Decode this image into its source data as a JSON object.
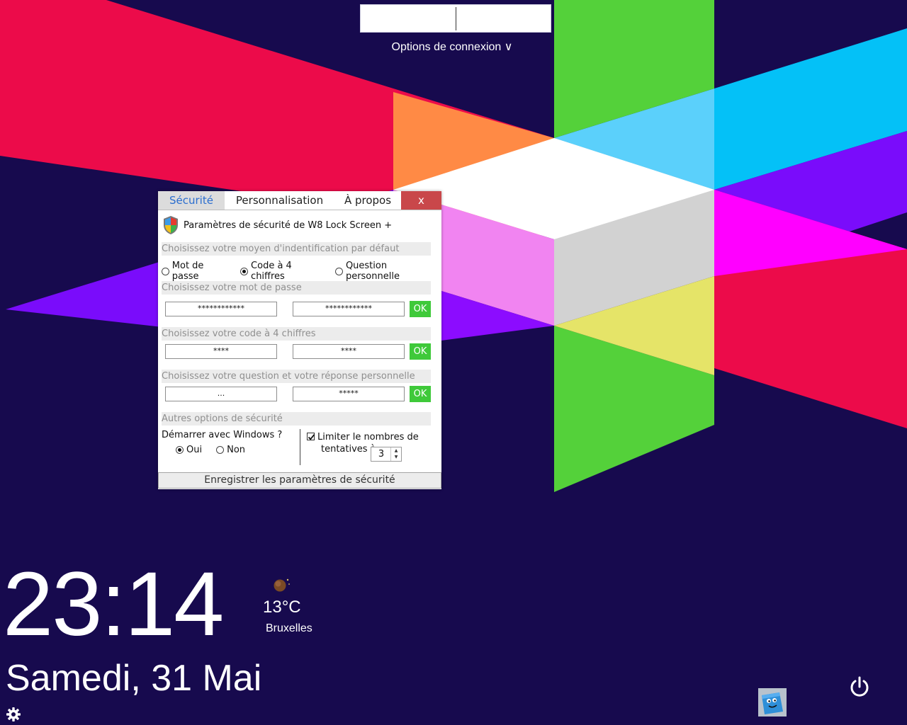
{
  "lock_screen": {
    "login_options_label": "Options de connexion ∨",
    "time": "23:14",
    "date": "Samedi, 31 Mai",
    "weather": {
      "temperature": "13°C",
      "city": "Bruxelles"
    },
    "icons": [
      "settings-gear-icon",
      "sticky-note-app-icon",
      "power-icon",
      "weather-moon-icon"
    ]
  },
  "dialog": {
    "tabs": [
      "Sécurité",
      "Personnalisation",
      "À propos"
    ],
    "active_tab": "Sécurité",
    "close_label": "x",
    "title": "Paramètres de sécurité de W8 Lock Screen +",
    "auth_section": {
      "heading": "Choisissez votre moyen d'indentification par défaut",
      "options": [
        "Mot de passe",
        "Code à 4 chiffres",
        "Question personnelle"
      ],
      "selected": "Code à 4 chiffres"
    },
    "password_section": {
      "heading": "Choisissez votre mot de passe",
      "field1": "************",
      "field2": "************",
      "ok": "OK"
    },
    "code_section": {
      "heading": "Choisissez votre code à 4 chiffres",
      "field1": "****",
      "field2": "****",
      "ok": "OK"
    },
    "question_section": {
      "heading": "Choisissez votre question et votre réponse personnelle",
      "field1": "...",
      "field2": "*****",
      "ok": "OK"
    },
    "other_section": {
      "heading": "Autres options de sécurité",
      "start_with_windows": "Démarrer avec Windows ?",
      "yes": "Oui",
      "no": "Non",
      "start_selected": "Oui",
      "limit_label_line1": "Limiter le nombres de",
      "limit_label_line2": "tentatives à",
      "limit_checked": true,
      "attempts": "3"
    },
    "save_label": "Enregistrer les paramètres de sécurité"
  },
  "colors": {
    "background": "#170a4e",
    "active_tab_text": "#2b6ecf",
    "close_button": "#c9474a",
    "ok_button": "#3fc93a"
  }
}
